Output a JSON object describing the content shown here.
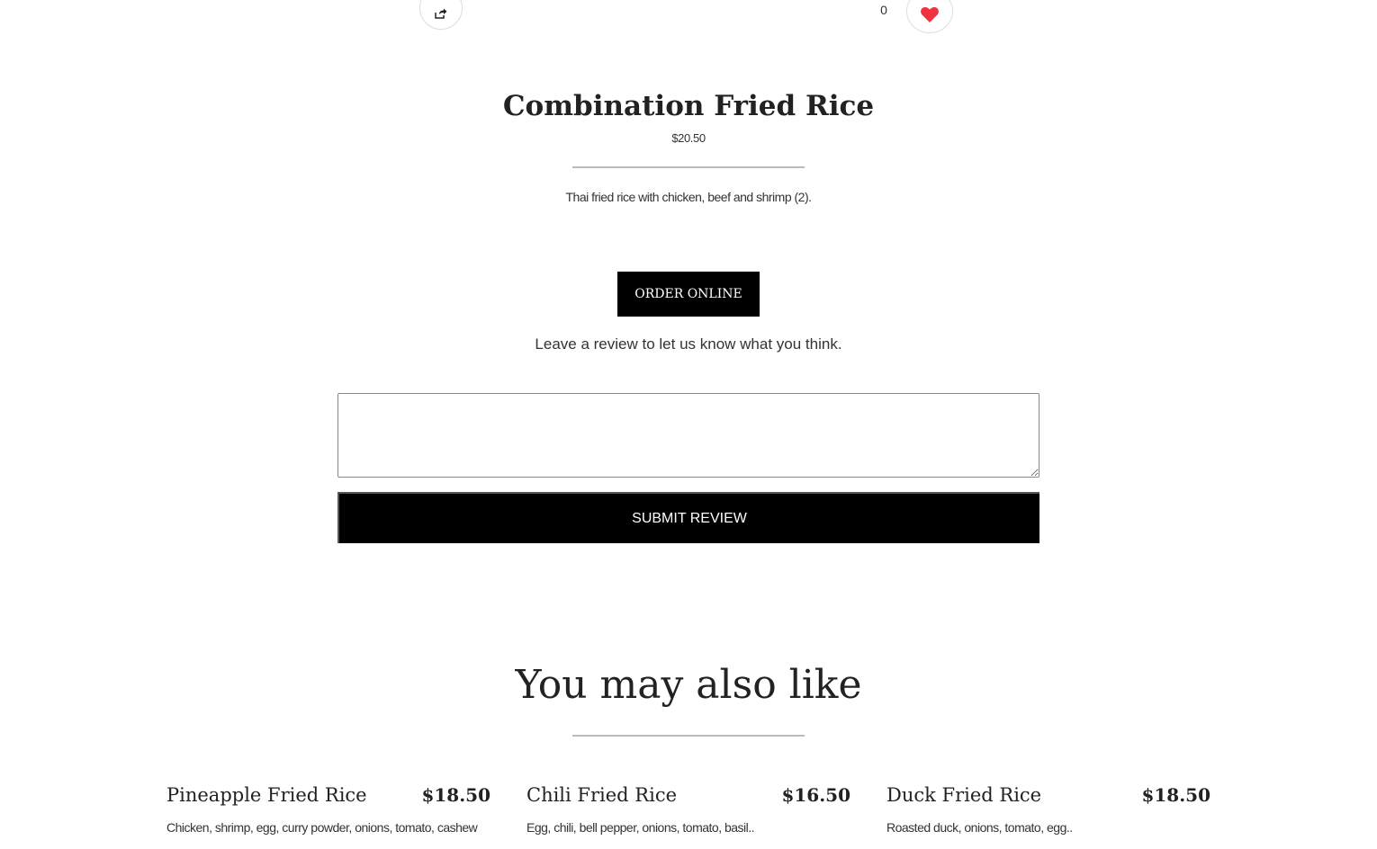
{
  "actions": {
    "share_icon": "share-icon",
    "like_icon": "heart-icon",
    "like_count": "0",
    "like_color": "#f0313f"
  },
  "item": {
    "title": "Combination Fried Rice",
    "price": "$20.50",
    "description": "Thai fried rice with chicken, beef and shrimp (2).",
    "order_label": "ORDER ONLINE"
  },
  "review": {
    "prompt": "Leave a review to let us know what you think.",
    "textarea_value": "",
    "submit_label": "SUBMIT REVIEW"
  },
  "recommendations": {
    "title": "You may also like",
    "items": [
      {
        "name": "Pineapple Fried Rice",
        "price": "$18.50",
        "description": "Chicken, shrimp, egg, curry powder, onions, tomato, cashew"
      },
      {
        "name": "Chili Fried Rice",
        "price": "$16.50",
        "description": "Egg, chili, bell pepper, onions, tomato, basil.."
      },
      {
        "name": "Duck Fried Rice",
        "price": "$18.50",
        "description": "Roasted duck, onions, tomato, egg.."
      }
    ]
  }
}
